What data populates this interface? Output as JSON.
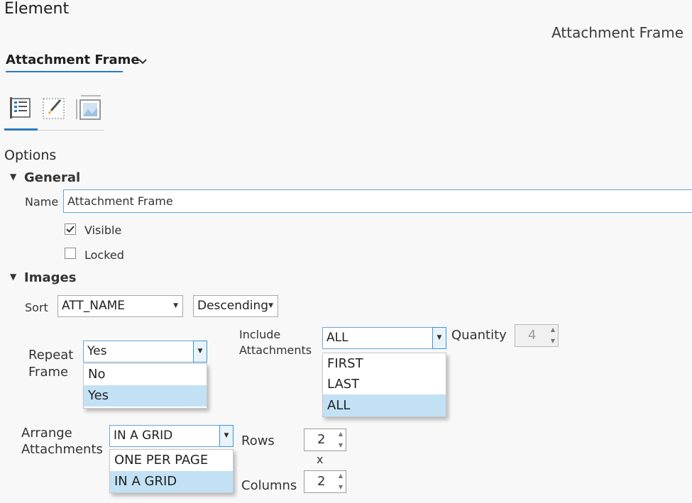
{
  "pane": {
    "title": "Element",
    "element_name": "Attachment Frame"
  },
  "selector": {
    "value": "Attachment Frame"
  },
  "tabs": [
    {
      "name": "Options",
      "icon": "options-list-icon"
    },
    {
      "name": "Display",
      "icon": "paintbrush-icon"
    },
    {
      "name": "Placement",
      "icon": "frame-size-icon"
    }
  ],
  "options_heading": "Options",
  "general": {
    "heading": "General",
    "name_label": "Name",
    "name_value": "Attachment Frame",
    "visible_label": "Visible",
    "visible_checked": true,
    "locked_label": "Locked",
    "locked_checked": false
  },
  "images": {
    "heading": "Images",
    "sort_label": "Sort",
    "sort_field": "ATT_NAME",
    "sort_order": "Descending",
    "repeat_frame": {
      "label_line1": "Repeat",
      "label_line2": "Frame",
      "value": "Yes",
      "options": [
        "No",
        "Yes"
      ],
      "selected": "Yes"
    },
    "include": {
      "label_line1": "Include",
      "label_line2": "Attachments",
      "value": "ALL",
      "options": [
        "FIRST",
        "LAST",
        "ALL"
      ],
      "selected": "ALL"
    },
    "quantity": {
      "label": "Quantity",
      "value": "4",
      "enabled": false
    },
    "arrange": {
      "label_line1": "Arrange",
      "label_line2": "Attachments",
      "value": "IN A GRID",
      "options": [
        "ONE PER PAGE",
        "IN A GRID"
      ],
      "selected": "IN A GRID"
    },
    "rows": {
      "label": "Rows",
      "value": "2"
    },
    "times_symbol": "x",
    "columns": {
      "label": "Columns",
      "value": "2"
    }
  },
  "colors": {
    "accent": "#2b7bbf",
    "selection": "#c3e1f5",
    "input_border": "#5aa9df"
  }
}
